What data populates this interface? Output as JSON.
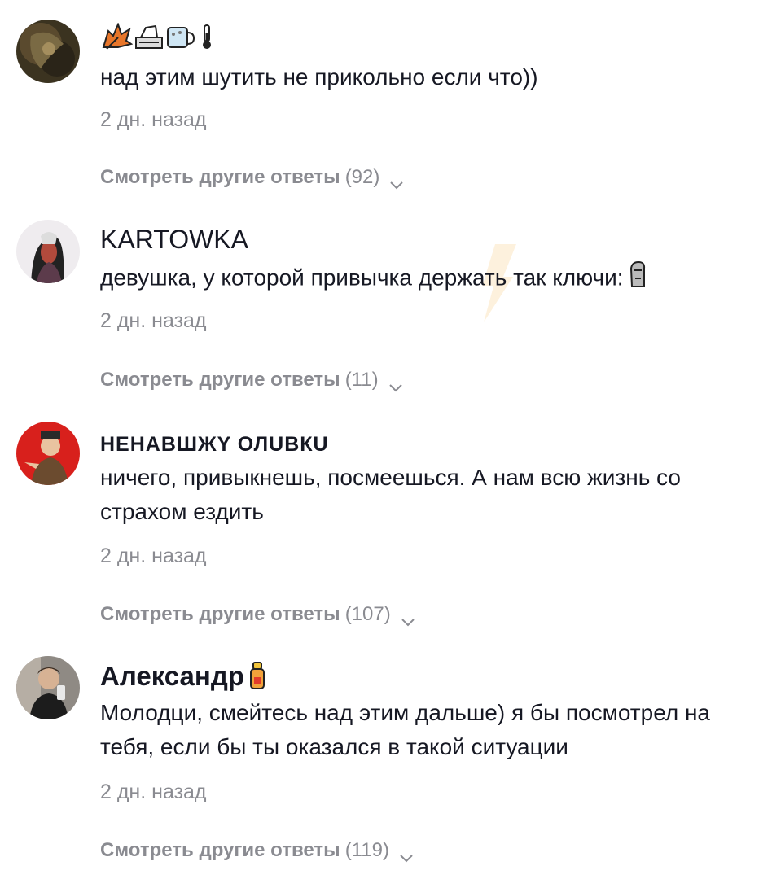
{
  "comments": [
    {
      "username_emojis": [
        "maple-leaf-icon",
        "typewriter-icon",
        "mug-icon",
        "thermometer-icon"
      ],
      "text": "над этим шутить не прикольно если что))",
      "time": "2 дн. назад",
      "replies_label": "Смотреть другие ответы",
      "replies_count": "(92)"
    },
    {
      "username": "KARTOWKA",
      "text": "девушка, у которой привычка держать так ключи:",
      "text_emoji": "moai-icon",
      "time": "2 дн. назад",
      "replies_label": "Смотреть другие ответы",
      "replies_count": "(11)"
    },
    {
      "username": "НЕНАВШЖY ОЛUВКU",
      "text": "ничего, привыкнешь, посмеешься. А нам всю жизнь со страхом ездить",
      "time": "2 дн. назад",
      "replies_label": "Смотреть другие ответы",
      "replies_count": "(107)"
    },
    {
      "username": "Александр",
      "username_emoji": "fire-extinguisher-icon",
      "text": "Молодци, смейтесь над этим дальше) я бы посмотрел на тебя, если бы ты оказался в такой ситуации",
      "time": "2 дн. назад",
      "replies_label": "Смотреть другие ответы",
      "replies_count": "(119)"
    }
  ],
  "colors": {
    "primary_text": "#161823",
    "secondary_text": "#8a8b91",
    "background": "#ffffff"
  }
}
